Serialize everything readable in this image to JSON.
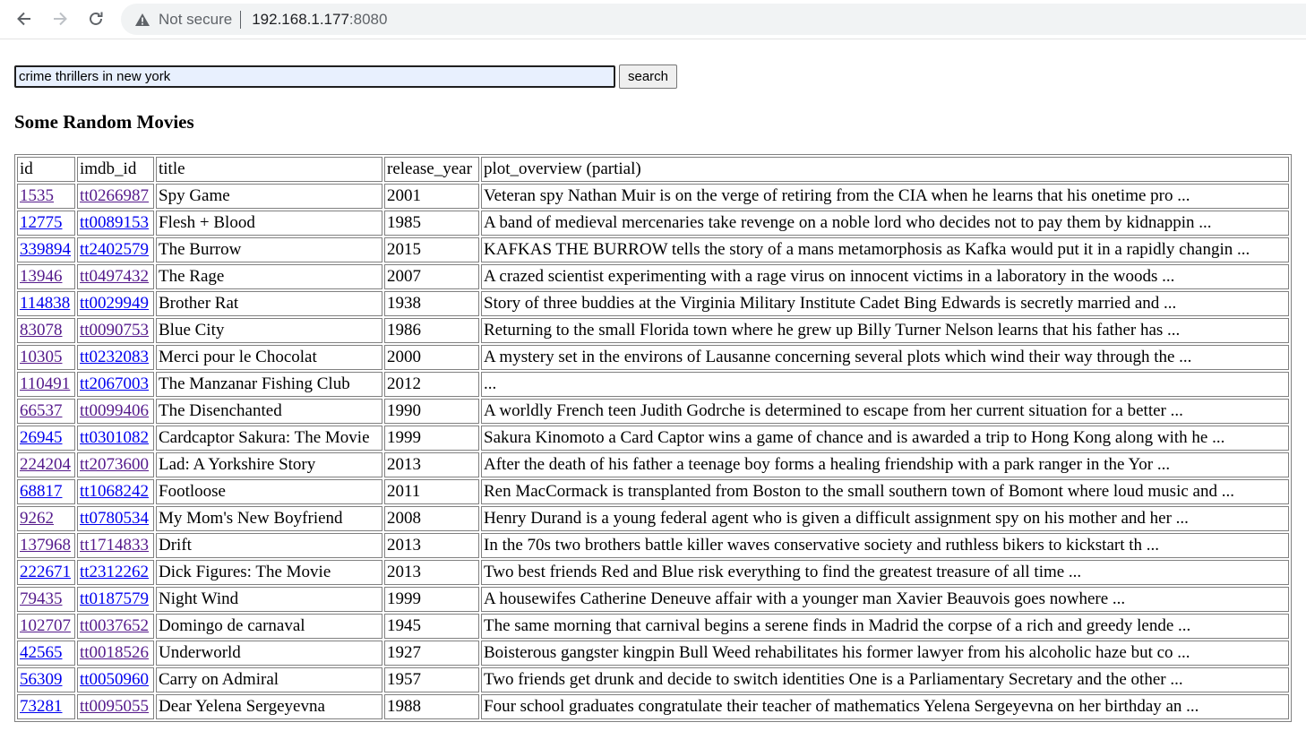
{
  "browser": {
    "security_label": "Not secure",
    "host": "192.168.1.177",
    "port": ":8080"
  },
  "search": {
    "value": "crime thrillers in new york",
    "button_label": "search"
  },
  "heading": "Some Random Movies",
  "table": {
    "headers": [
      "id",
      "imdb_id",
      "title",
      "release_year",
      "plot_overview (partial)"
    ],
    "rows": [
      {
        "id": "1535",
        "imdb_id": "tt0266987",
        "title": "Spy Game",
        "release_year": "2001",
        "plot": "Veteran spy Nathan Muir is on the verge of retiring from the CIA when he learns that his onetime pro ...",
        "id_visited": true,
        "imdb_visited": true
      },
      {
        "id": "12775",
        "imdb_id": "tt0089153",
        "title": "Flesh + Blood",
        "release_year": "1985",
        "plot": "A band of medieval mercenaries take revenge on a noble lord who decides not to pay them by kidnappin ...",
        "id_visited": false,
        "imdb_visited": false
      },
      {
        "id": "339894",
        "imdb_id": "tt2402579",
        "title": "The Burrow",
        "release_year": "2015",
        "plot": "KAFKAS THE BURROW tells the story of a mans metamorphosis as Kafka would put it in a rapidly changin ...",
        "id_visited": false,
        "imdb_visited": false
      },
      {
        "id": "13946",
        "imdb_id": "tt0497432",
        "title": "The Rage",
        "release_year": "2007",
        "plot": "A crazed scientist experimenting with a rage virus on innocent victims in a laboratory in the woods ...",
        "id_visited": true,
        "imdb_visited": true
      },
      {
        "id": "114838",
        "imdb_id": "tt0029949",
        "title": "Brother Rat",
        "release_year": "1938",
        "plot": "Story of three buddies at the Virginia Military Institute Cadet Bing Edwards is secretly married and ...",
        "id_visited": false,
        "imdb_visited": false
      },
      {
        "id": "83078",
        "imdb_id": "tt0090753",
        "title": "Blue City",
        "release_year": "1986",
        "plot": "Returning to the small Florida town where he grew up Billy Turner Nelson learns that his father has ...",
        "id_visited": true,
        "imdb_visited": true
      },
      {
        "id": "10305",
        "imdb_id": "tt0232083",
        "title": "Merci pour le Chocolat",
        "release_year": "2000",
        "plot": "A mystery set in the environs of Lausanne concerning several plots which wind their way through the ...",
        "id_visited": true,
        "imdb_visited": false
      },
      {
        "id": "110491",
        "imdb_id": "tt2067003",
        "title": "The Manzanar Fishing Club",
        "release_year": "2012",
        "plot": "...",
        "id_visited": true,
        "imdb_visited": false
      },
      {
        "id": "66537",
        "imdb_id": "tt0099406",
        "title": "The Disenchanted",
        "release_year": "1990",
        "plot": "A worldly French teen Judith Godrche is determined to escape from her current situation for a better ...",
        "id_visited": true,
        "imdb_visited": true
      },
      {
        "id": "26945",
        "imdb_id": "tt0301082",
        "title": "Cardcaptor Sakura: The Movie",
        "release_year": "1999",
        "plot": "Sakura Kinomoto a Card Captor wins a game of chance and is awarded a trip to Hong Kong along with he ...",
        "id_visited": false,
        "imdb_visited": false
      },
      {
        "id": "224204",
        "imdb_id": "tt2073600",
        "title": "Lad: A Yorkshire Story",
        "release_year": "2013",
        "plot": "After the death of his father a teenage boy forms a healing friendship with a park ranger in the Yor ...",
        "id_visited": true,
        "imdb_visited": true
      },
      {
        "id": "68817",
        "imdb_id": "tt1068242",
        "title": "Footloose",
        "release_year": "2011",
        "plot": "Ren MacCormack is transplanted from Boston to the small southern town of Bomont where loud music and ...",
        "id_visited": false,
        "imdb_visited": false
      },
      {
        "id": "9262",
        "imdb_id": "tt0780534",
        "title": "My Mom's New Boyfriend",
        "release_year": "2008",
        "plot": "Henry Durand is a young federal agent who is given a difficult assignment spy on his mother and her ...",
        "id_visited": true,
        "imdb_visited": false
      },
      {
        "id": "137968",
        "imdb_id": "tt1714833",
        "title": "Drift",
        "release_year": "2013",
        "plot": "In the 70s two brothers battle killer waves conservative society and ruthless bikers to kickstart th ...",
        "id_visited": true,
        "imdb_visited": true
      },
      {
        "id": "222671",
        "imdb_id": "tt2312262",
        "title": "Dick Figures: The Movie",
        "release_year": "2013",
        "plot": "Two best friends Red and Blue risk everything to find the greatest treasure of all time ...",
        "id_visited": false,
        "imdb_visited": false
      },
      {
        "id": "79435",
        "imdb_id": "tt0187579",
        "title": "Night Wind",
        "release_year": "1999",
        "plot": "A housewifes Catherine Deneuve affair with a younger man Xavier Beauvois goes nowhere ...",
        "id_visited": true,
        "imdb_visited": false
      },
      {
        "id": "102707",
        "imdb_id": "tt0037652",
        "title": "Domingo de carnaval",
        "release_year": "1945",
        "plot": "The same morning that carnival begins a serene finds in Madrid the corpse of a rich and greedy lende ...",
        "id_visited": true,
        "imdb_visited": true
      },
      {
        "id": "42565",
        "imdb_id": "tt0018526",
        "title": "Underworld",
        "release_year": "1927",
        "plot": "Boisterous gangster kingpin Bull Weed rehabilitates his former lawyer from his alcoholic haze but co ...",
        "id_visited": false,
        "imdb_visited": true
      },
      {
        "id": "56309",
        "imdb_id": "tt0050960",
        "title": "Carry on Admiral",
        "release_year": "1957",
        "plot": "Two friends get drunk and decide to switch identities One is a Parliamentary Secretary and the other ...",
        "id_visited": false,
        "imdb_visited": false
      },
      {
        "id": "73281",
        "imdb_id": "tt0095055",
        "title": "Dear Yelena Sergeyevna",
        "release_year": "1988",
        "plot": "Four school graduates congratulate their teacher of mathematics Yelena Sergeyevna on her birthday an ...",
        "id_visited": false,
        "imdb_visited": true
      }
    ]
  },
  "colors": {
    "link_visited": "#551a8b",
    "link_unvisited": "#0000ee",
    "input_autofill_bg": "#e8f0fe"
  }
}
